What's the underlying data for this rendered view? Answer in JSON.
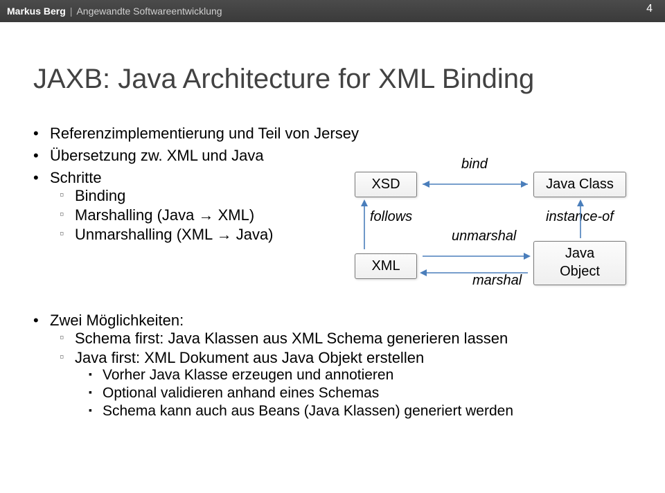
{
  "header": {
    "author": "Markus Berg",
    "course": "Angewandte Softwareentwicklung"
  },
  "pageNumber": "4",
  "title": "JAXB: Java Architecture for XML Binding",
  "bullets": {
    "b1": "Referenzimplementierung und Teil von Jersey",
    "b2": "Übersetzung zw. XML und Java",
    "b3": "Schritte",
    "b3a": "Binding",
    "b3b_pre": "Marshalling (Java ",
    "b3b_post": " XML)",
    "b3c_pre": "Unmarshalling (XML ",
    "b3c_post": " Java)",
    "b4": "Zwei Möglichkeiten:",
    "b4a": "Schema first: Java Klassen aus XML Schema generieren lassen",
    "b4b": "Java first: XML Dokument aus Java Objekt erstellen",
    "b4b1": "Vorher Java Klasse erzeugen und annotieren",
    "b4b2": "Optional validieren anhand eines Schemas",
    "b4b3": "Schema kann auch aus Beans (Java Klassen) generiert werden"
  },
  "arrow": "→",
  "diagram": {
    "xsd": "XSD",
    "xml": "XML",
    "javaClass": "Java Class",
    "javaObjectL1": "Java",
    "javaObjectL2": "Object",
    "bind": "bind",
    "follows": "follows",
    "unmarshal": "unmarshal",
    "marshal": "marshal",
    "instanceOf": "instance-of"
  }
}
